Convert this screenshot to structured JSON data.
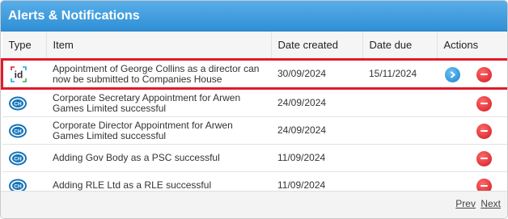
{
  "panel": {
    "title": "Alerts & Notifications"
  },
  "columns": {
    "type": "Type",
    "item": "Item",
    "date_created": "Date created",
    "date_due": "Date due",
    "actions": "Actions"
  },
  "rows": [
    {
      "icon": "id-check-icon",
      "item": "Appointment of George Collins as a director can now be submitted to Companies House",
      "date_created": "30/09/2024",
      "date_due": "15/11/2024",
      "has_go": true,
      "highlighted": true
    },
    {
      "icon": "companies-house-icon",
      "item": "Corporate Secretary Appointment for Arwen Games Limited successful",
      "date_created": "24/09/2024",
      "date_due": "",
      "has_go": false,
      "highlighted": false
    },
    {
      "icon": "companies-house-icon",
      "item": "Corporate Director Appointment for Arwen Games Limited successful",
      "date_created": "24/09/2024",
      "date_due": "",
      "has_go": false,
      "highlighted": false
    },
    {
      "icon": "companies-house-icon",
      "item": "Adding Gov Body as a PSC successful",
      "date_created": "11/09/2024",
      "date_due": "",
      "has_go": false,
      "highlighted": false
    },
    {
      "icon": "companies-house-icon",
      "item": "Adding RLE Ltd as a RLE successful",
      "date_created": "11/09/2024",
      "date_due": "",
      "has_go": false,
      "highlighted": false
    }
  ],
  "pagination": {
    "prev": "Prev",
    "next": "Next"
  },
  "colors": {
    "header_blue": "#3b9ae0",
    "highlight_red": "#e01b2b",
    "delete_red": "#d01822",
    "go_blue": "#1a7fcf"
  }
}
